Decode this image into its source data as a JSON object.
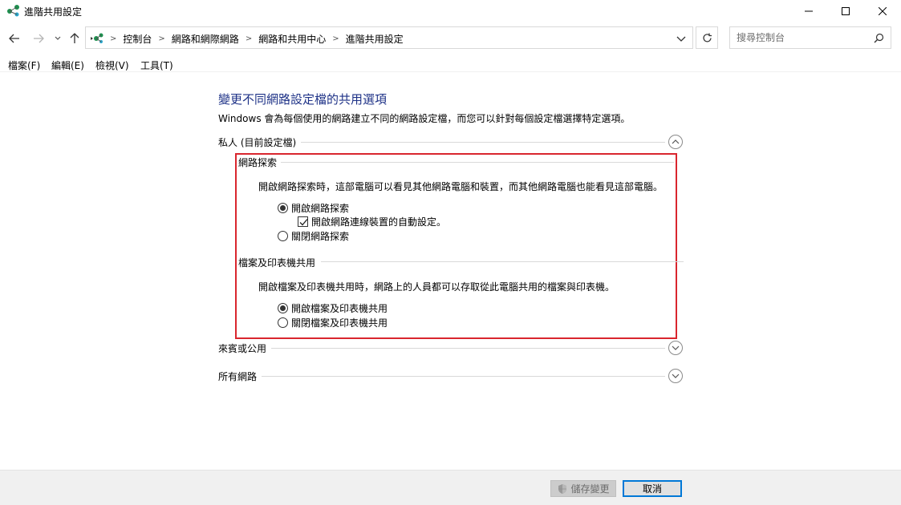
{
  "window": {
    "title": "進階共用設定"
  },
  "address": {
    "breadcrumbs": [
      "控制台",
      "網路和網際網路",
      "網路和共用中心",
      "進階共用設定"
    ],
    "search_placeholder": "搜尋控制台"
  },
  "menu": {
    "items": [
      "檔案(F)",
      "編輯(E)",
      "檢視(V)",
      "工具(T)"
    ]
  },
  "content": {
    "title": "變更不同網路設定檔的共用選項",
    "description": "Windows 會為每個使用的網路建立不同的網路設定檔，而您可以針對每個設定檔選擇特定選項。",
    "profiles": {
      "private": {
        "label": "私人 (目前設定檔)",
        "expanded": true,
        "network_discovery": {
          "header": "網路探索",
          "help": "開啟網路探索時，這部電腦可以看見其他網路電腦和裝置，而其他網路電腦也能看見這部電腦。",
          "on_label": "開啟網路探索",
          "auto_setup_label": "開啟網路連線裝置的自動設定。",
          "off_label": "關閉網路探索",
          "selected": "on",
          "auto_setup_checked": true
        },
        "file_printer_sharing": {
          "header": "檔案及印表機共用",
          "help": "開啟檔案及印表機共用時，網路上的人員都可以存取從此電腦共用的檔案與印表機。",
          "on_label": "開啟檔案及印表機共用",
          "off_label": "關閉檔案及印表機共用",
          "selected": "on"
        }
      },
      "guest_public": {
        "label": "來賓或公用",
        "expanded": false
      },
      "all_networks": {
        "label": "所有網路",
        "expanded": false
      }
    }
  },
  "footer": {
    "save_label": "儲存變更",
    "cancel_label": "取消"
  },
  "colors": {
    "title_blue": "#1e3287",
    "highlight_red": "#d9262e",
    "focus_blue": "#0078d7"
  }
}
